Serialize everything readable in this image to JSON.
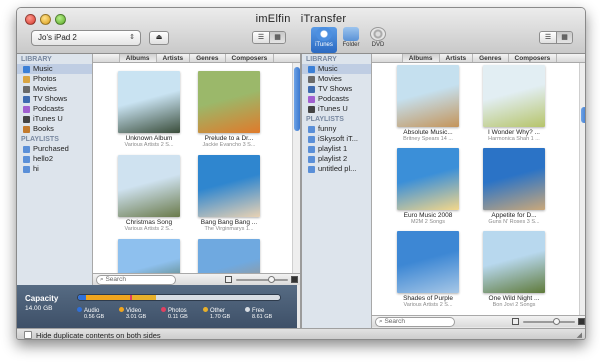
{
  "window": {
    "title_left": "imElfin",
    "title_right": "iTransfer"
  },
  "left": {
    "device": "Jo's iPad 2",
    "eject_glyph": "⏏",
    "tabs": [
      "Albums",
      "Artists",
      "Genres",
      "Composers"
    ],
    "library_header": "LIBRARY",
    "library": [
      {
        "label": "Music",
        "color": "#3b7fd6"
      },
      {
        "label": "Photos",
        "color": "#d9a441"
      },
      {
        "label": "Movies",
        "color": "#6a6a6a"
      },
      {
        "label": "TV Shows",
        "color": "#3f6bb0"
      },
      {
        "label": "Podcasts",
        "color": "#a15fd0"
      },
      {
        "label": "iTunes U",
        "color": "#444444"
      },
      {
        "label": "Books",
        "color": "#c37b2e"
      }
    ],
    "playlists_header": "PLAYLISTS",
    "playlists": [
      {
        "label": "Purchased",
        "color": "#5a8fd8"
      },
      {
        "label": "hello2",
        "color": "#5a8fd8"
      },
      {
        "label": "hi",
        "color": "#5a8fd8"
      }
    ],
    "albums": [
      {
        "title": "Unknown Album",
        "artist": "Various Artists 2 S...",
        "c1": "#c9e3f2",
        "c2": "#3a4d3a"
      },
      {
        "title": "Prelude to a Dr...",
        "artist": "Jackie Evancho 3 S...",
        "c1": "#9bb86a",
        "c2": "#e07a2a"
      },
      {
        "title": "Christmas Song",
        "artist": "Various Artists 2 S...",
        "c1": "#cfe2f0",
        "c2": "#6a7a4a"
      },
      {
        "title": "Bang Bang Bang ...",
        "artist": "The Virginmarys 1...",
        "c1": "#2f86cf",
        "c2": "#e8d2b4"
      },
      {
        "title": "",
        "artist": "",
        "c1": "#8ec0ee",
        "c2": "#3a5a2a"
      },
      {
        "title": "",
        "artist": "",
        "c1": "#6fa9e0",
        "c2": "#b68a5a"
      }
    ],
    "search_placeholder": "Search",
    "capacity": {
      "label": "Capacity",
      "total": "14.00 GB",
      "segments": [
        {
          "name": "Audio",
          "size": "0.56 GB",
          "color": "#2f6fd8",
          "pct": 4
        },
        {
          "name": "Video",
          "size": "3.01 GB",
          "color": "#f0a51e",
          "pct": 21.5
        },
        {
          "name": "Photos",
          "size": "0.11 GB",
          "color": "#e04060",
          "pct": 1
        },
        {
          "name": "Other",
          "size": "1.70 GB",
          "color": "#e8b02a",
          "pct": 12
        },
        {
          "name": "Free",
          "size": "8.61 GB",
          "color": "#d8dde3",
          "pct": 61.5
        }
      ]
    },
    "footer_checkbox": "Hide duplicate contents on both sides"
  },
  "right": {
    "source_tabs": [
      {
        "label": "iTunes",
        "active": true
      },
      {
        "label": "Folder",
        "active": false
      },
      {
        "label": "DVD",
        "active": false
      }
    ],
    "tabs": [
      "Albums",
      "Artists",
      "Genres",
      "Composers"
    ],
    "library_header": "LIBRARY",
    "library": [
      {
        "label": "Music",
        "color": "#3b7fd6"
      },
      {
        "label": "Movies",
        "color": "#6a6a6a"
      },
      {
        "label": "TV Shows",
        "color": "#3f6bb0"
      },
      {
        "label": "Podcasts",
        "color": "#a15fd0"
      },
      {
        "label": "iTunes U",
        "color": "#444444"
      }
    ],
    "playlists_header": "PLAYLISTS",
    "playlists": [
      {
        "label": "funny",
        "color": "#5a8fd8"
      },
      {
        "label": "iSkysoft iT...",
        "color": "#5a8fd8"
      },
      {
        "label": "playlist 1",
        "color": "#5a8fd8"
      },
      {
        "label": "playlist 2",
        "color": "#5a8fd8"
      },
      {
        "label": "untitled pl...",
        "color": "#5a8fd8"
      }
    ],
    "albums": [
      {
        "title": "Absolute Music...",
        "artist": "Britney Spears 14 ...",
        "c1": "#c5e0ef",
        "c2": "#c4945a"
      },
      {
        "title": "I Wonder Why? ...",
        "artist": "Harmonica Shah 1 ...",
        "c1": "#e2eef3",
        "c2": "#b6c46a"
      },
      {
        "title": "Euro Music 2008",
        "artist": "M2M 2 Songs",
        "c1": "#3b8fd8",
        "c2": "#f3d78a"
      },
      {
        "title": "Appetite for D...",
        "artist": "Guns N' Roses 3 S...",
        "c1": "#2b73c6",
        "c2": "#caa87a"
      },
      {
        "title": "Shades of Purple",
        "artist": "Various Artists 2 S...",
        "c1": "#3d87d4",
        "c2": "#a7c7e6"
      },
      {
        "title": "One Wild Night ...",
        "artist": "Bon Jovi 2 Songs",
        "c1": "#b8d8ee",
        "c2": "#5f7a3a"
      }
    ],
    "search_placeholder": "Search"
  },
  "icons": {
    "grid_view": "grid-view-icon",
    "list_view": "list-view-icon",
    "search": "search-icon"
  }
}
